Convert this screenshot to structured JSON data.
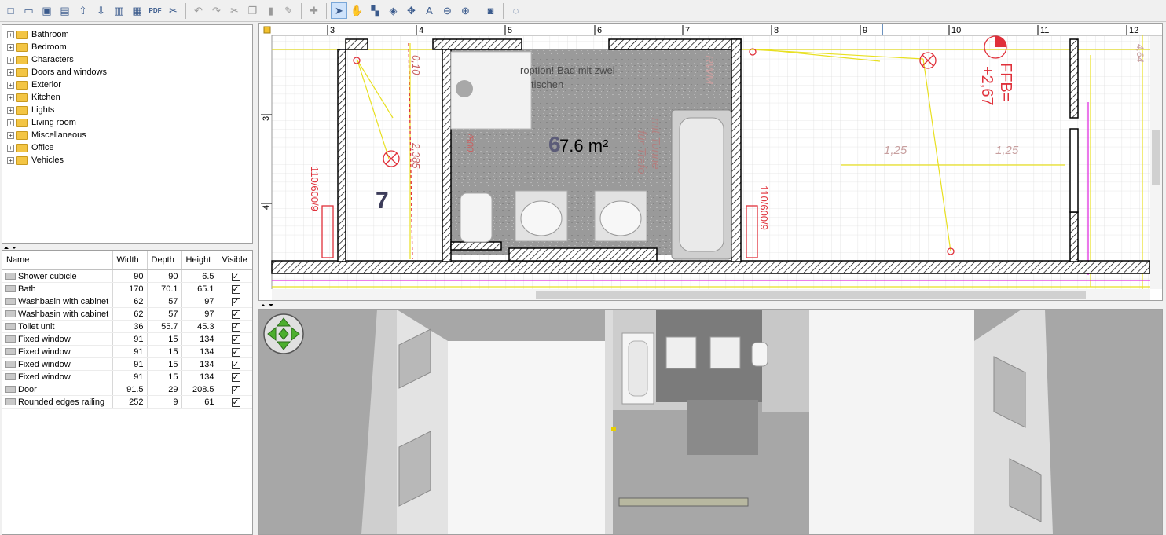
{
  "toolbar": {
    "pdf_label": "PDF"
  },
  "furniture_tree": [
    {
      "label": "Bathroom"
    },
    {
      "label": "Bedroom"
    },
    {
      "label": "Characters"
    },
    {
      "label": "Doors and windows"
    },
    {
      "label": "Exterior"
    },
    {
      "label": "Kitchen"
    },
    {
      "label": "Lights"
    },
    {
      "label": "Living room"
    },
    {
      "label": "Miscellaneous"
    },
    {
      "label": "Office"
    },
    {
      "label": "Vehicles"
    }
  ],
  "furniture_table": {
    "columns": [
      "Name",
      "Width",
      "Depth",
      "Height",
      "Visible"
    ],
    "rows": [
      {
        "name": "Shower cubicle",
        "width": "90",
        "depth": "90",
        "height": "6.5",
        "visible": true
      },
      {
        "name": "Bath",
        "width": "170",
        "depth": "70.1",
        "height": "65.1",
        "visible": true
      },
      {
        "name": "Washbasin with cabinet",
        "width": "62",
        "depth": "57",
        "height": "97",
        "visible": true
      },
      {
        "name": "Washbasin with cabinet",
        "width": "62",
        "depth": "57",
        "height": "97",
        "visible": true
      },
      {
        "name": "Toilet unit",
        "width": "36",
        "depth": "55.7",
        "height": "45.3",
        "visible": true
      },
      {
        "name": "Fixed window",
        "width": "91",
        "depth": "15",
        "height": "134",
        "visible": true
      },
      {
        "name": "Fixed window",
        "width": "91",
        "depth": "15",
        "height": "134",
        "visible": true
      },
      {
        "name": "Fixed window",
        "width": "91",
        "depth": "15",
        "height": "134",
        "visible": true
      },
      {
        "name": "Fixed window",
        "width": "91",
        "depth": "15",
        "height": "134",
        "visible": true
      },
      {
        "name": "Door",
        "width": "91.5",
        "depth": "29",
        "height": "208.5",
        "visible": true
      },
      {
        "name": "Rounded edges railing",
        "width": "252",
        "depth": "9",
        "height": "61",
        "visible": true
      }
    ]
  },
  "plan": {
    "ruler_top": [
      "3",
      "4",
      "5",
      "6",
      "7",
      "8",
      "9",
      "10",
      "11",
      "12"
    ],
    "ruler_left": [
      "3",
      "4"
    ],
    "room_area": "7.6 m²",
    "room_number_a": "6",
    "room_number_b": "7",
    "note_line1": "roption! Bad mit zwei",
    "note_line2": "tischen",
    "ffb_line1": "FFB=",
    "ffb_line2": "+2,67",
    "dim_left_vertical": "110/600/9",
    "dim_right_vertical": "110/600/9",
    "dim_010": "0,10",
    "dim_2385": "2,385",
    "dim_800": "/800",
    "dim_125a": "1,25",
    "dim_125b": "1,25",
    "dim_right_edge": "4,64",
    "rwm_label": "RWM",
    "mit_line1": "mit Tunne",
    "mit_line2": "für Trafo"
  },
  "colors": {
    "wall_outline": "#000000",
    "annotation_red": "#e0303a",
    "annotation_yellow": "#e8e020",
    "floor_gray": "#9a9a9a"
  }
}
